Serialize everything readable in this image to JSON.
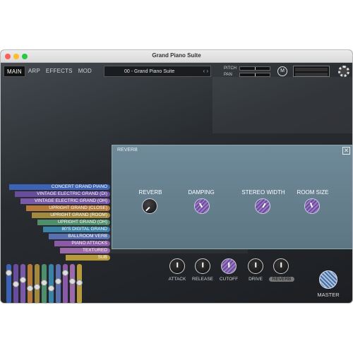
{
  "window": {
    "title": "Grand Piano Suite"
  },
  "nav": {
    "tabs": [
      "MAIN",
      "ARP",
      "EFFECTS",
      "MOD"
    ],
    "active": "MAIN"
  },
  "preset": {
    "name": "00 - Grand Piano Suite"
  },
  "controls": {
    "pitch_label": "PITCH",
    "pan_label": "PAN",
    "m_button": "M"
  },
  "reverb": {
    "title": "REVERB",
    "close_glyph": "✕",
    "knobs": [
      {
        "label": "REVERB",
        "style": "black"
      },
      {
        "label": "DAMPING",
        "style": "purple"
      },
      {
        "label": "STEREO WIDTH",
        "style": "purple"
      },
      {
        "label": "ROOM SIZE",
        "style": "purple"
      }
    ]
  },
  "layers": [
    {
      "label": "CONCERT GRAND PIANO",
      "color": "#3d63b6"
    },
    {
      "label": "VINTAGE ELECTRIC GRAND (DI)",
      "color": "#6a4c9c"
    },
    {
      "label": "VINTAGE ELECTRIC GRAND (OH)",
      "color": "#7a5aa8"
    },
    {
      "label": "UPRIGHT GRAND (CLOSE)",
      "color": "#b57a3a"
    },
    {
      "label": "UPRIGHT GRAND (ROOM)",
      "color": "#a3893d"
    },
    {
      "label": "UPRIGHT GRAND (OH)",
      "color": "#4e8e6a"
    },
    {
      "label": "80'S DIGITAL GRAND",
      "color": "#3b82a8"
    },
    {
      "label": "BALLROOM VERB",
      "color": "#5a6fb0"
    },
    {
      "label": "PIANO ATTACKS",
      "color": "#8a5aa8"
    },
    {
      "label": "TEXTURED",
      "color": "#9c6aa8"
    },
    {
      "label": "SUB",
      "color": "#b89a3a"
    }
  ],
  "bottom_controls": [
    {
      "label": "ATTACK",
      "style": "dark",
      "active": false
    },
    {
      "label": "RELEASE",
      "style": "dark",
      "active": false
    },
    {
      "label": "CUTOFF",
      "style": "purple",
      "active": false
    },
    {
      "label": "DRIVE",
      "style": "dark",
      "active": false
    },
    {
      "label": "REVERB",
      "style": "dark",
      "active": true
    }
  ],
  "master": {
    "label": "MASTER"
  }
}
